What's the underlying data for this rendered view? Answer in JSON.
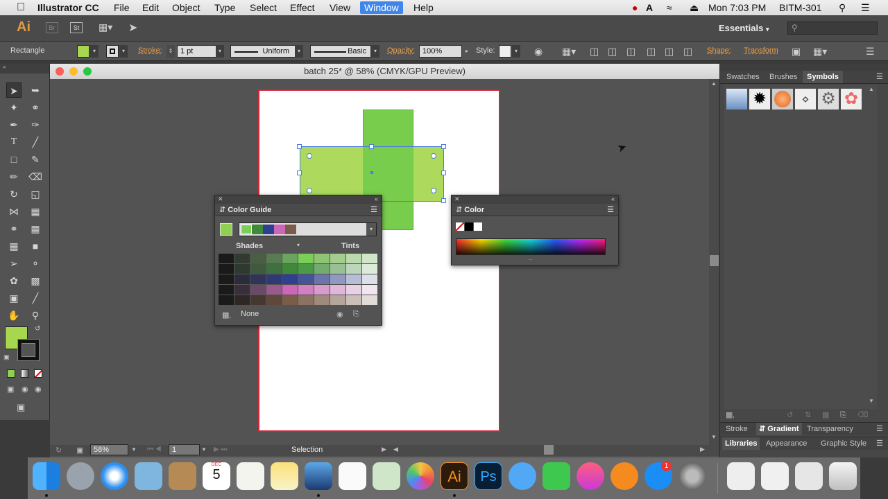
{
  "menubar": {
    "app_name": "Illustrator CC",
    "items": [
      "File",
      "Edit",
      "Object",
      "Type",
      "Select",
      "Effect",
      "View",
      "Window",
      "Help"
    ],
    "active_item": "Window",
    "clock": "Mon 7:03 PM",
    "user": "BITM-301"
  },
  "appbar": {
    "logo": "Ai",
    "workspace": "Essentials"
  },
  "controlbar": {
    "object_type": "Rectangle",
    "fill_color": "#a7d74f",
    "stroke_label": "Stroke:",
    "stroke_weight": "1 pt",
    "stroke_profile": "Uniform",
    "brush": "Basic",
    "opacity_label": "Opacity:",
    "opacity_value": "100%",
    "style_label": "Style:",
    "shape_label": "Shape:",
    "transform_label": "Transform"
  },
  "document": {
    "title": "batch 25* @ 58% (CMYK/GPU Preview)",
    "zoom": "58%",
    "artboard": "1",
    "status": "Selection"
  },
  "color_guide": {
    "title": "Color Guide",
    "shades_label": "Shades",
    "tints_label": "Tints",
    "footer_label": "None",
    "harmony_colors": [
      "#7ccf56",
      "#3e8a3a",
      "#2f3f8f",
      "#cc66b8",
      "#7a5c48"
    ],
    "grid_rows": [
      [
        "#1a1a1a",
        "#333a31",
        "#4a5e44",
        "#5a7a52",
        "#6aa45e",
        "#7ccf56",
        "#8fc472",
        "#a3cc8e",
        "#bad9ac",
        "#d1e6c9"
      ],
      [
        "#1a1a1a",
        "#2f3a2f",
        "#3f5a3d",
        "#3e7040",
        "#3e8a3a",
        "#4a9a48",
        "#72ad6e",
        "#97c194",
        "#bbd6b9",
        "#dcead9"
      ],
      [
        "#1a1a1a",
        "#2a2c3a",
        "#2f3458",
        "#2f3a74",
        "#2f3f8f",
        "#45539b",
        "#6b75ac",
        "#9199c0",
        "#b8bdd6",
        "#dcdeea"
      ],
      [
        "#1a1a1a",
        "#3a2e3a",
        "#6a4a66",
        "#9a5a8e",
        "#cc66b8",
        "#d27fc4",
        "#d99bce",
        "#e0b6da",
        "#e8d0e5",
        "#f1e6f0"
      ],
      [
        "#1a1a1a",
        "#2e2824",
        "#463830",
        "#5e483c",
        "#7a5c48",
        "#8c7260",
        "#a08a7c",
        "#b6a59a",
        "#cbc0b9",
        "#e2dcd7"
      ]
    ]
  },
  "color_panel": {
    "title": "Color"
  },
  "dock": {
    "tabs_top": [
      "Swatches",
      "Brushes",
      "Symbols"
    ],
    "active_top": "Symbols",
    "tabs_mid": [
      "Stroke",
      "Gradient",
      "Transparency"
    ],
    "active_mid": "Gradient",
    "tabs_bot": [
      "Libraries",
      "Appearance",
      "Graphic Style"
    ],
    "active_bot": "Libraries"
  },
  "toolbar": {
    "fill_color": "#a7d74f"
  },
  "os_dock": {
    "calendar_month": "DEC",
    "calendar_day": "5",
    "ai_label": "Ai",
    "ps_label": "Ps",
    "appstore_badge": "1"
  }
}
